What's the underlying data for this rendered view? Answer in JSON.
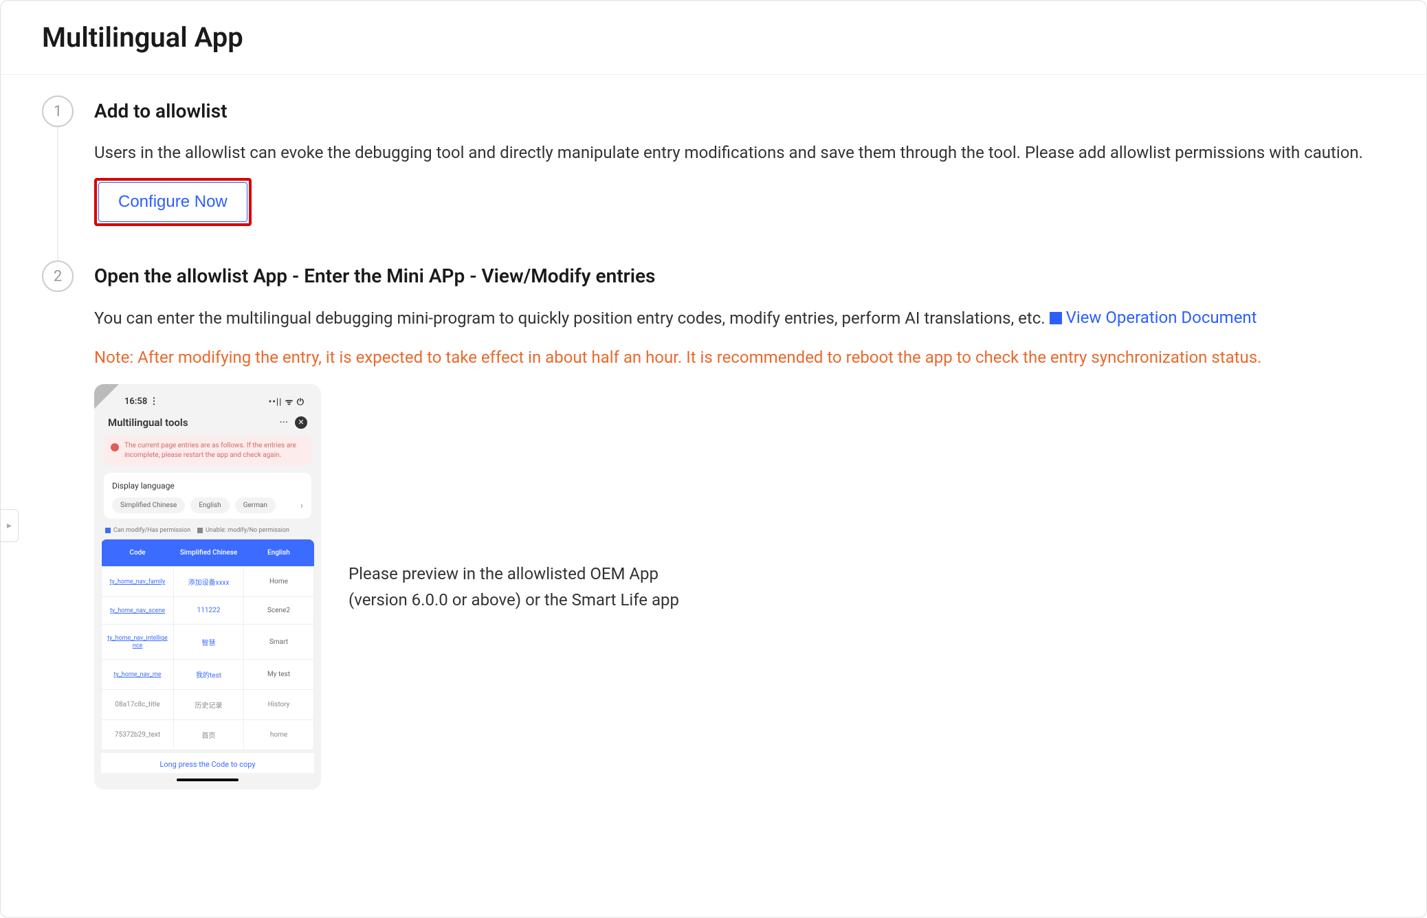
{
  "page": {
    "title": "Multilingual App"
  },
  "step1": {
    "number": "1",
    "title": "Add to allowlist",
    "desc": "Users in the allowlist can evoke the debugging tool and directly manipulate entry modifications and save them through the tool. Please add allowlist permissions with caution.",
    "button": "Configure Now"
  },
  "step2": {
    "number": "2",
    "title": "Open the allowlist App - Enter the Mini APp - View/Modify entries",
    "desc": "You can enter the multilingual debugging mini-program to quickly position entry codes, modify entries, perform AI translations, etc.",
    "doc_link": "View Operation Document",
    "note": "Note: After modifying the entry, it is expected to take effect in about half an hour. It is recommended to reboot the app to check the entry synchronization status.",
    "preview_line1": "Please preview in the allowlisted OEM App",
    "preview_line2": "(version 6.0.0 or above) or the Smart Life app"
  },
  "phone": {
    "time": "16:58 ⋮",
    "signal": "••|| ᯤ ⏻",
    "title": "Multilingual tools",
    "more": "···",
    "banner": "The current page entries are as follows. If the entries are incomplete, please restart the app and check again.",
    "lang_label": "Display language",
    "chips": [
      "Simplified Chinese",
      "English",
      "German"
    ],
    "legend_can": "Can modify/Has permission",
    "legend_unable": "Unable: modify/No permission",
    "headers": {
      "code": "Code",
      "cn": "Simplified Chinese",
      "en": "English"
    },
    "rows": [
      {
        "code": "ty_home_nav_family",
        "cn": "添加设备xxxx",
        "en": "Home"
      },
      {
        "code": "ty_home_nav_scene",
        "cn": "111222",
        "en": "Scene2"
      },
      {
        "code": "ty_home_nav_intelligence",
        "cn": "智慧",
        "en": "Smart"
      },
      {
        "code": "ty_home_nav_me",
        "cn": "我的test",
        "en": "My test"
      },
      {
        "code": "08a17c8c_title",
        "cn": "历史记录",
        "en": "History",
        "grey": true
      },
      {
        "code": "75372b29_text",
        "cn": "首页",
        "en": "home",
        "grey": true
      }
    ],
    "footer": "Long press the Code to copy"
  },
  "side_handle_glyph": "▸"
}
